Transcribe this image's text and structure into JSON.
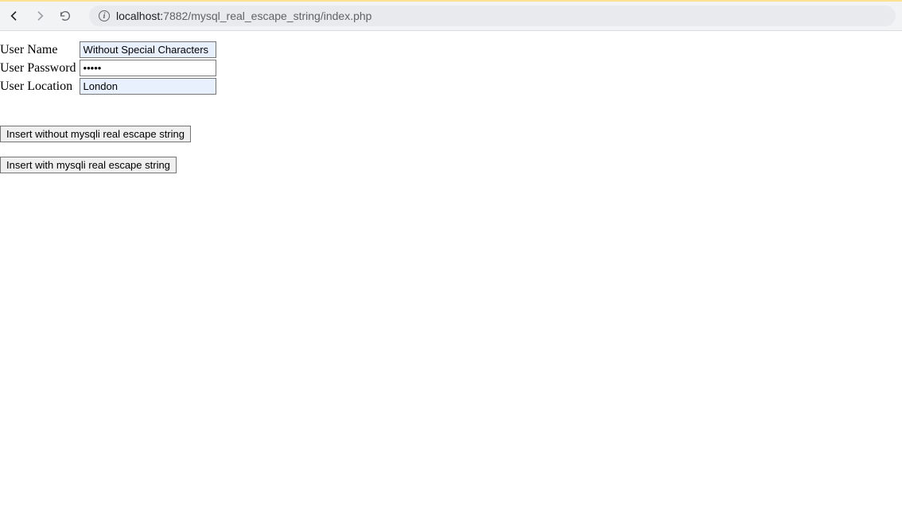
{
  "browser": {
    "url_prefix": "localhost:",
    "url_rest": "7882/mysql_real_escape_string/index.php"
  },
  "form": {
    "labels": {
      "username": "User Name",
      "password": "User Password",
      "location": "User Location"
    },
    "values": {
      "username": "Without Special Characters",
      "password": "•••••",
      "location": "London"
    }
  },
  "buttons": {
    "insert_without": "Insert without mysqli real escape string",
    "insert_with": "Insert with mysqli real escape string"
  }
}
